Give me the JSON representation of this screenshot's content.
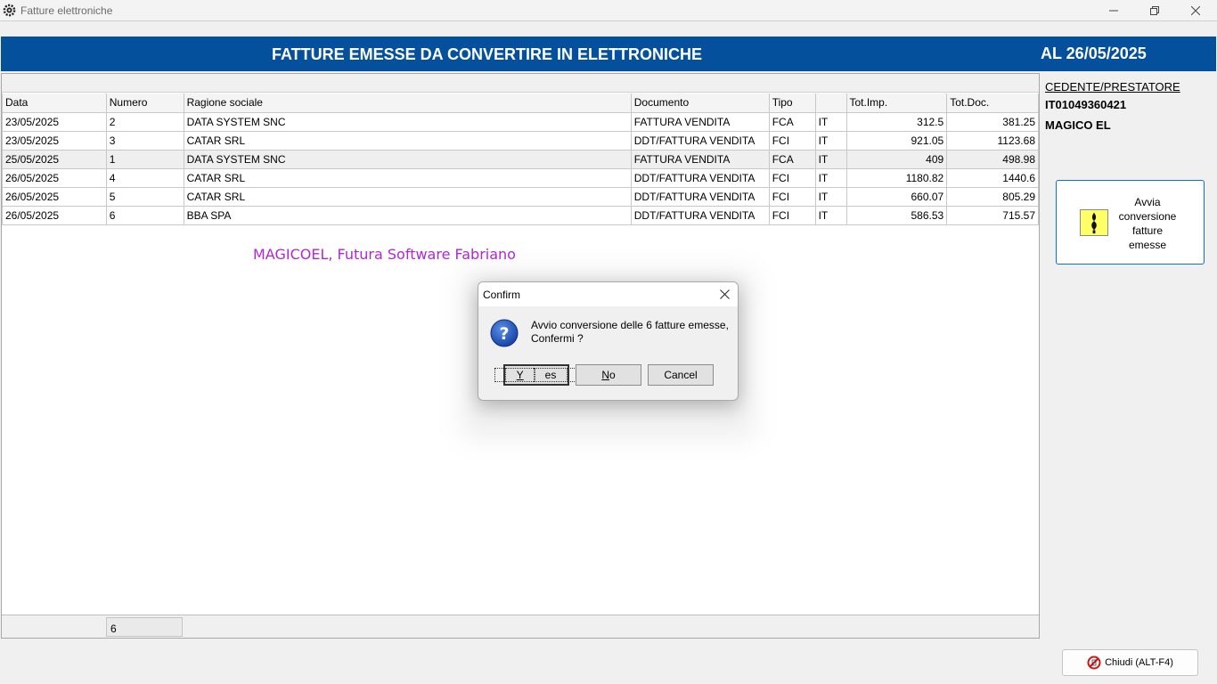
{
  "window": {
    "title": "Fatture elettroniche",
    "icon": "gear-icon"
  },
  "banner": {
    "title": "FATTURE EMESSE DA CONVERTIRE IN ELETTRONICHE",
    "date": "AL 26/05/2025",
    "color": "#04509c"
  },
  "grid": {
    "columns": [
      "Data",
      "Numero",
      "Ragione sociale",
      "Documento",
      "Tipo",
      "",
      "Tot.Imp.",
      "Tot.Doc."
    ],
    "rows": [
      [
        "23/05/2025",
        "2",
        "DATA SYSTEM SNC",
        "FATTURA VENDITA",
        "FCA",
        "IT",
        "312.5",
        "381.25"
      ],
      [
        "23/05/2025",
        "3",
        "CATAR SRL",
        "DDT/FATTURA VENDITA",
        "FCI",
        "IT",
        "921.05",
        "1123.68"
      ],
      [
        "25/05/2025",
        "1",
        "DATA SYSTEM SNC",
        "FATTURA VENDITA",
        "FCA",
        "IT",
        "409",
        "498.98"
      ],
      [
        "26/05/2025",
        "4",
        "CATAR SRL",
        "DDT/FATTURA VENDITA",
        "FCI",
        "IT",
        "1180.82",
        "1440.6"
      ],
      [
        "26/05/2025",
        "5",
        "CATAR SRL",
        "DDT/FATTURA VENDITA",
        "FCI",
        "IT",
        "660.07",
        "805.29"
      ],
      [
        "26/05/2025",
        "6",
        "BBA SPA",
        "DDT/FATTURA VENDITA",
        "FCI",
        "IT",
        "586.53",
        "715.57"
      ]
    ],
    "footer_count": "6"
  },
  "watermark": "MAGICOEL, Futura Software Fabriano",
  "right_panel": {
    "label": "CEDENTE/PRESTATORE",
    "code": "IT01049360421",
    "name": "MAGICO EL",
    "convert_button": "Avvia\nconversione\nfatture\nemesse"
  },
  "close_button": "Chiudi (ALT-F4)",
  "dialog": {
    "title": "Confirm",
    "message": "Avvio conversione delle 6 fatture emesse, Confermi ?",
    "yes_rest": "es",
    "no_rest": "o",
    "cancel": "Cancel"
  }
}
